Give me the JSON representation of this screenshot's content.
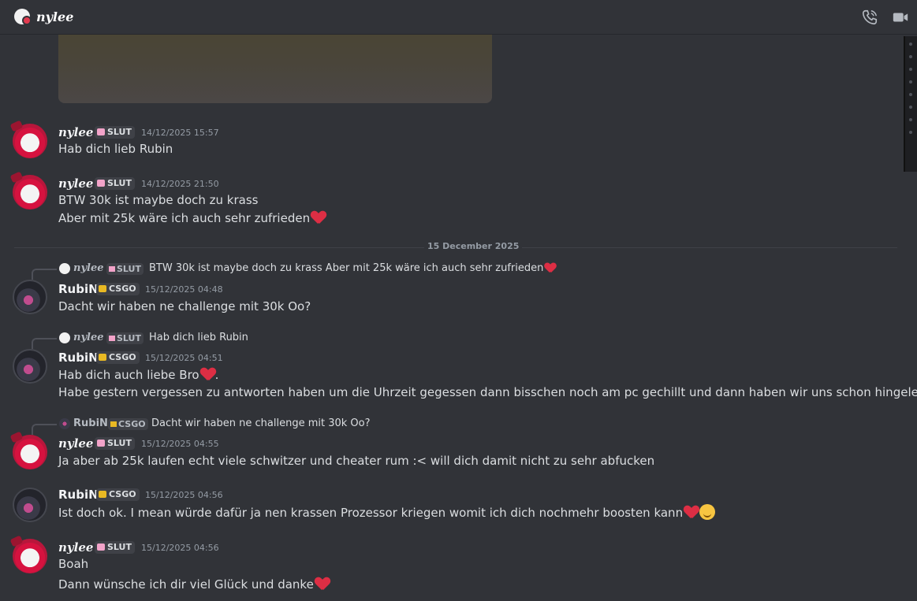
{
  "header": {
    "title": "nylee",
    "call_icon": "phone-icon",
    "video_icon": "video-camera-icon"
  },
  "date_divider": "15 December 2025",
  "messages": [
    {
      "author": "nylee",
      "tag": "SLUT",
      "timestamp": "14/12/2025 15:57",
      "lines": [
        "Hab dich lieb Rubin"
      ]
    },
    {
      "author": "nylee",
      "tag": "SLUT",
      "timestamp": "14/12/2025 21:50",
      "lines": [
        "BTW 30k ist maybe doch zu krass",
        "Aber mit 25k wäre ich auch sehr zufrieden"
      ]
    },
    {
      "reply": {
        "author": "nylee",
        "tag": "SLUT",
        "text": "BTW 30k ist maybe doch zu krass Aber mit 25k wäre ich auch sehr zufrieden"
      },
      "author": "RubiN",
      "tag": "CSGO",
      "timestamp": "15/12/2025 04:48",
      "lines": [
        "Dacht wir haben ne challenge mit 30k Oo?"
      ]
    },
    {
      "reply": {
        "author": "nylee",
        "tag": "SLUT",
        "text": "Hab dich lieb Rubin"
      },
      "author": "RubiN",
      "tag": "CSGO",
      "timestamp": "15/12/2025 04:51",
      "lines": [
        "Hab dich auch liebe Bro",
        ".",
        "Habe gestern vergessen zu antworten haben um die Uhrzeit gegessen dann bisschen noch am pc gechillt und dann haben wir uns schon hingelegt"
      ]
    },
    {
      "reply": {
        "author": "RubiN",
        "tag": "CSGO",
        "text": "Dacht wir haben ne challenge mit 30k Oo?"
      },
      "author": "nylee",
      "tag": "SLUT",
      "timestamp": "15/12/2025 04:55",
      "lines": [
        "Ja aber ab 25k laufen echt viele schwitzer und cheater rum :< will dich damit nicht zu sehr abfucken"
      ]
    },
    {
      "author": "RubiN",
      "tag": "CSGO",
      "timestamp": "15/12/2025 04:56",
      "lines": [
        "Ist doch ok. I mean würde dafür ja nen krassen Prozessor kriegen womit ich dich nochmehr boosten kann"
      ]
    },
    {
      "author": "nylee",
      "tag": "SLUT",
      "timestamp": "15/12/2025 04:56",
      "lines": [
        "Boah",
        "Dann wünsche ich dir viel Glück und danke"
      ]
    }
  ],
  "colors": {
    "background": "#313338",
    "heart": "#dd2e44",
    "slut_badge": "#f2a3c9",
    "csgo_badge": "#e9b923"
  }
}
